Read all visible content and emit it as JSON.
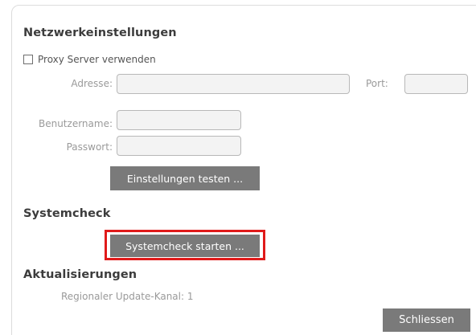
{
  "dialog": {
    "network": {
      "title": "Netzwerkeinstellungen",
      "proxy_checkbox": {
        "label": "Proxy Server verwenden",
        "checked": false
      },
      "address": {
        "label": "Adresse:",
        "value": ""
      },
      "port": {
        "label": "Port:",
        "value": ""
      },
      "username": {
        "label": "Benutzername:",
        "value": ""
      },
      "password": {
        "label": "Passwort:",
        "value": ""
      },
      "test_button": "Einstellungen testen ..."
    },
    "systemcheck": {
      "title": "Systemcheck",
      "start_button": "Systemcheck starten ..."
    },
    "updates": {
      "title": "Aktualisierungen",
      "channel_text": "Regionaler Update-Kanal: 1"
    },
    "close_button": "Schliessen"
  },
  "colors": {
    "button_bg": "#7a7a7a",
    "highlight": "#e01a1a",
    "label_text": "#9a9a9a",
    "title_text": "#3c3c3c"
  }
}
